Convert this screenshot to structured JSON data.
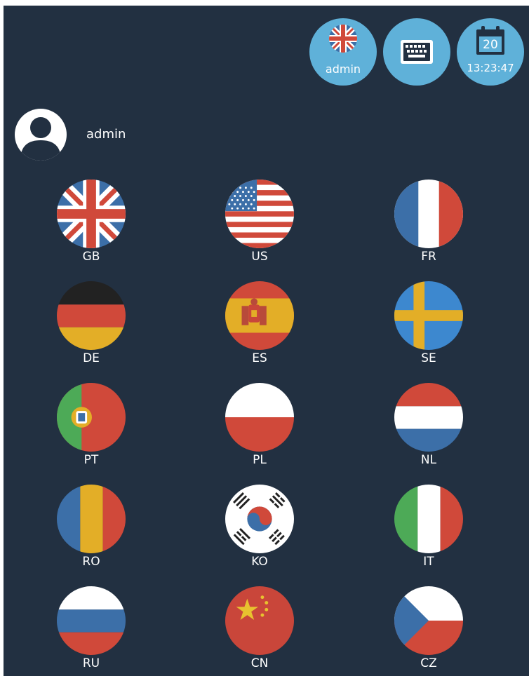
{
  "header": {
    "language_button": {
      "label": "admin",
      "icon": "uk-flag-icon"
    },
    "keyboard_button": {
      "icon": "keyboard-icon"
    },
    "clock_button": {
      "day": "20",
      "time": "13:23:47",
      "icon": "calendar-icon"
    }
  },
  "user": {
    "name": "admin",
    "avatar_icon": "user-avatar-icon"
  },
  "languages": [
    {
      "code": "GB"
    },
    {
      "code": "US"
    },
    {
      "code": "FR"
    },
    {
      "code": "DE"
    },
    {
      "code": "ES"
    },
    {
      "code": "SE"
    },
    {
      "code": "PT"
    },
    {
      "code": "PL"
    },
    {
      "code": "NL"
    },
    {
      "code": "RO"
    },
    {
      "code": "KO"
    },
    {
      "code": "IT"
    },
    {
      "code": "RU"
    },
    {
      "code": "CN"
    },
    {
      "code": "CZ"
    }
  ],
  "colors": {
    "background": "#223041",
    "button_blue": "#5fb1d9",
    "flag_blue": "#3c6fa8",
    "flag_red": "#d0493a",
    "flag_white": "#ffffff"
  }
}
